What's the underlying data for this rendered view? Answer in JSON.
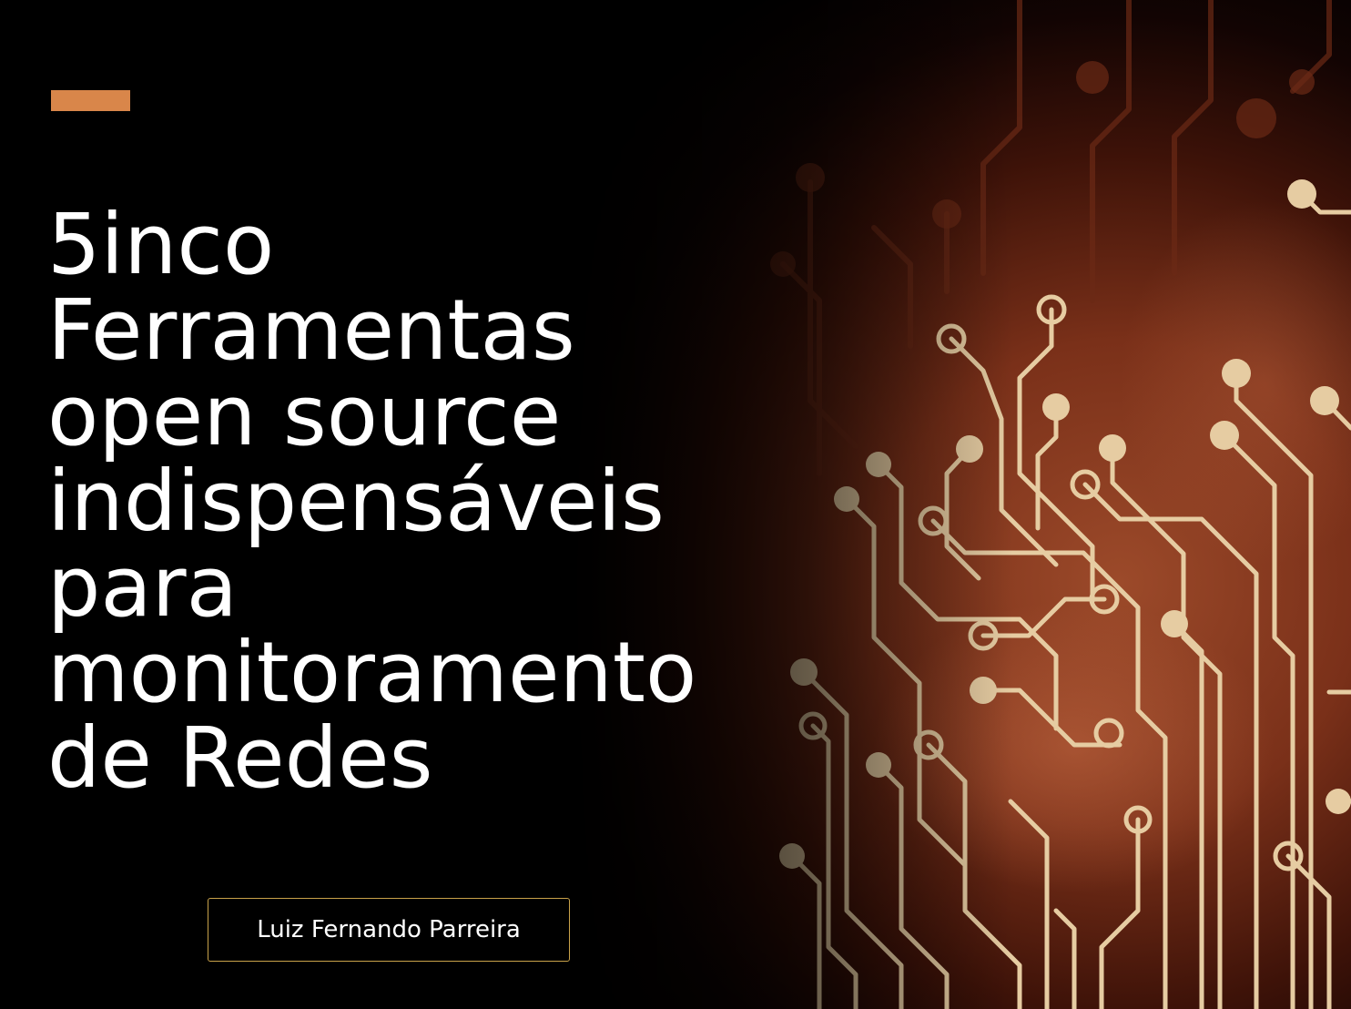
{
  "slide": {
    "title_lines": [
      "5inco",
      "Ferramentas",
      "open source",
      "indispensáveis",
      "para",
      "monitoramento",
      "de Redes"
    ],
    "author": "Luiz Fernando Parreira"
  },
  "colors": {
    "background": "#000000",
    "accent": "#d9864a",
    "title_text": "#ffffff",
    "author_border": "#c9a24a",
    "circuit_glow": "#8a3a1c",
    "circuit_trace": "#e8cfa6"
  },
  "background_image": {
    "icon": "circuit-board-traces"
  }
}
